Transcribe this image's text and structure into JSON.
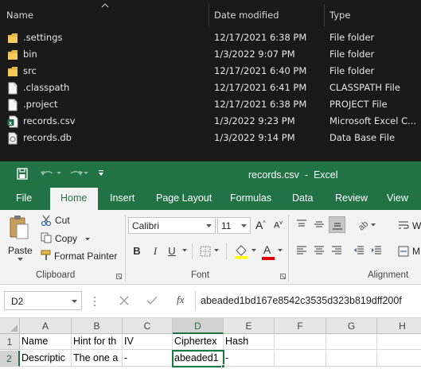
{
  "explorer": {
    "columns": {
      "name": "Name",
      "date": "Date modified",
      "type": "Type"
    },
    "files": [
      {
        "name": ".settings",
        "date": "12/17/2021 6:38 PM",
        "type": "File folder",
        "icon": "folder-icon"
      },
      {
        "name": "bin",
        "date": "1/3/2022 9:07 PM",
        "type": "File folder",
        "icon": "folder-icon"
      },
      {
        "name": "src",
        "date": "12/17/2021 6:40 PM",
        "type": "File folder",
        "icon": "folder-icon"
      },
      {
        "name": ".classpath",
        "date": "12/17/2021 6:41 PM",
        "type": "CLASSPATH File",
        "icon": "file-icon"
      },
      {
        "name": ".project",
        "date": "12/17/2021 6:38 PM",
        "type": "PROJECT File",
        "icon": "file-icon"
      },
      {
        "name": "records.csv",
        "date": "1/3/2022 9:23 PM",
        "type": "Microsoft Excel C...",
        "icon": "excel-csv-icon"
      },
      {
        "name": "records.db",
        "date": "1/3/2022 9:14 PM",
        "type": "Data Base File",
        "icon": "database-file-icon"
      }
    ]
  },
  "excel": {
    "title": "records.csv  -  Excel",
    "tabs": [
      "File",
      "Home",
      "Insert",
      "Page Layout",
      "Formulas",
      "Data",
      "Review",
      "View"
    ],
    "active_tab": "Home",
    "clipboard": {
      "paste": "Paste",
      "cut": "Cut",
      "copy": "Copy",
      "format_painter": "Format Painter",
      "label": "Clipboard"
    },
    "font": {
      "name": "Calibri",
      "size": "11",
      "label": "Font",
      "bold": "B",
      "italic": "I",
      "underline": "U"
    },
    "alignment": {
      "label": "Alignment",
      "wrap": "W",
      "merge": "M"
    },
    "name_box": "D2",
    "fx": "fx",
    "formula": "abeaded1bd167e8542c3535d323b819dff200f",
    "columns": [
      "A",
      "B",
      "C",
      "D",
      "E",
      "F",
      "G",
      "H"
    ],
    "rows": [
      {
        "num": "1",
        "cells": [
          "Name",
          "Hint for th",
          "IV",
          "",
          "Ciphertex",
          "Hash",
          "",
          ""
        ]
      },
      {
        "num": "2",
        "cells": [
          "Descriptic",
          "The one a",
          "-",
          "",
          "abeaded1",
          "-",
          "",
          ""
        ]
      }
    ]
  },
  "colors": {
    "excel_green": "#217346",
    "explorer_bg": "#191919",
    "selection": "#107c41"
  }
}
